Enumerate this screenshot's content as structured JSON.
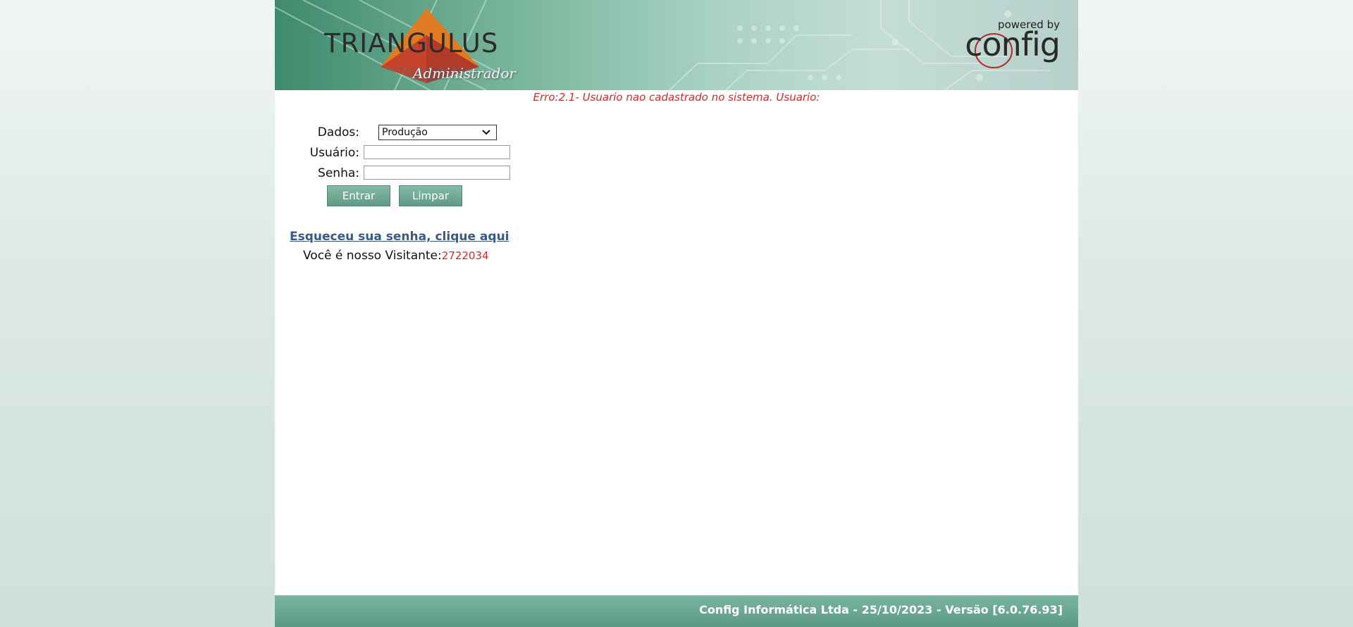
{
  "header": {
    "logo_text": "TRIANGULUS",
    "logo_subtitle": "Administrador",
    "powered_by": "powered by",
    "brand": "config"
  },
  "error_message": "Erro:2.1- Usuario nao cadastrado no sistema. Usuario:",
  "form": {
    "dados_label": "Dados:",
    "dados_selected": "Produção",
    "usuario_label": "Usuário:",
    "usuario_value": "",
    "senha_label": "Senha:",
    "senha_value": "",
    "enter_button": "Entrar",
    "clear_button": "Limpar"
  },
  "forgot_password_link": "Esqueceu sua senha, clique aqui",
  "visitor": {
    "label": "Você é nosso Visitante:",
    "count": "2722034"
  },
  "footer": {
    "text": "Config Informática Ltda - 25/10/2023 - Versão [6.0.76.93]"
  },
  "colors": {
    "accent_green": "#5f9a84",
    "error_red": "#d12b2b",
    "link_blue": "#3a5a86"
  }
}
